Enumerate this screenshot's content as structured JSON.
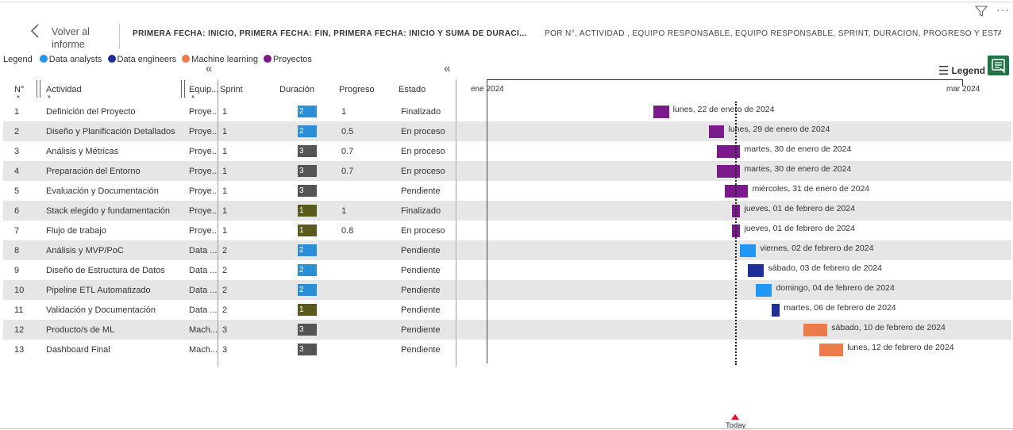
{
  "header": {
    "back_icon": "chevron-left-icon",
    "back_label": "Volver al informe",
    "title_1": "PRIMERA FECHA: INICIO, PRIMERA FECHA: FIN, PRIMERA FECHA: INICIO Y SUMA DE DURACI...",
    "title_2": "POR N°, ACTIVIDAD , EQUIPO RESPONSABLE, EQUIPO RESPONSABLE, SPRINT, DURACIÓN, PROGRESO Y ESTA...",
    "filter_icon": "filter-icon",
    "more_icon": "more-options-icon"
  },
  "legend": {
    "title": "Legend",
    "items": [
      {
        "label": "Data analysts",
        "color": "#2196f3"
      },
      {
        "label": "Data engineers",
        "color": "#1f2f9a"
      },
      {
        "label": "Machine learning",
        "color": "#ec7a4b"
      },
      {
        "label": "Proyectos",
        "color": "#7b1a8a"
      }
    ]
  },
  "columns": {
    "num": "N°",
    "actividad": "Actividad",
    "equipo": "Equip...",
    "sprint": "Sprint",
    "duracion": "Duración",
    "progreso": "Progreso",
    "estado": "Estado"
  },
  "rows": [
    {
      "n": "1",
      "actividad": "Definición del Proyecto",
      "equipo": "Proye...",
      "sprint": "1",
      "duracion": "2",
      "progreso": "1",
      "estado": "Finalizado",
      "bar_label": "lunes, 22 de enero de 2024"
    },
    {
      "n": "2",
      "actividad": "Diseño y Planificación Detallados",
      "equipo": "Proye...",
      "sprint": "1",
      "duracion": "2",
      "progreso": "0.5",
      "estado": "En proceso",
      "bar_label": "lunes, 29 de enero de 2024"
    },
    {
      "n": "3",
      "actividad": "Análisis y Métricas",
      "equipo": "Proye...",
      "sprint": "1",
      "duracion": "3",
      "progreso": "0.7",
      "estado": "En proceso",
      "bar_label": "martes, 30 de enero de 2024"
    },
    {
      "n": "4",
      "actividad": "Preparación del Entorno",
      "equipo": "Proye...",
      "sprint": "1",
      "duracion": "3",
      "progreso": "0.7",
      "estado": "En proceso",
      "bar_label": "martes, 30 de enero de 2024"
    },
    {
      "n": "5",
      "actividad": "Evaluación y Documentación",
      "equipo": "Proye...",
      "sprint": "1",
      "duracion": "3",
      "progreso": "",
      "estado": "Pendiente",
      "bar_label": "miércoles, 31 de enero de 2024"
    },
    {
      "n": "6",
      "actividad": "Stack elegido y fundamentación",
      "equipo": "Proye...",
      "sprint": "1",
      "duracion": "1",
      "progreso": "1",
      "estado": "Finalizado",
      "bar_label": "jueves, 01 de febrero de 2024"
    },
    {
      "n": "7",
      "actividad": "Flujo de trabajo",
      "equipo": "Proye...",
      "sprint": "1",
      "duracion": "1",
      "progreso": "0.8",
      "estado": "En proceso",
      "bar_label": "jueves, 01 de febrero de 2024"
    },
    {
      "n": "8",
      "actividad": "Análisis y MVP/PoC",
      "equipo": "Data ...",
      "sprint": "2",
      "duracion": "2",
      "progreso": "",
      "estado": "Pendiente",
      "bar_label": "viernes, 02 de febrero de 2024"
    },
    {
      "n": "9",
      "actividad": "Diseño de Estructura de Datos",
      "equipo": "Data ...",
      "sprint": "2",
      "duracion": "2",
      "progreso": "",
      "estado": "Pendiente",
      "bar_label": "sábado, 03 de febrero de 2024"
    },
    {
      "n": "10",
      "actividad": "Pipeline ETL Automatizado",
      "equipo": "Data ...",
      "sprint": "2",
      "duracion": "2",
      "progreso": "",
      "estado": "Pendiente",
      "bar_label": "domingo, 04 de febrero de 2024"
    },
    {
      "n": "11",
      "actividad": "Validación y Documentación",
      "equipo": "Data ...",
      "sprint": "2",
      "duracion": "1",
      "progreso": "",
      "estado": "Pendiente",
      "bar_label": "martes, 06 de febrero de 2024"
    },
    {
      "n": "12",
      "actividad": "Producto/s de ML",
      "equipo": "Mach...",
      "sprint": "3",
      "duracion": "3",
      "progreso": "",
      "estado": "Pendiente",
      "bar_label": "sábado, 10 de febrero de 2024"
    },
    {
      "n": "13",
      "actividad": "Dashboard Final",
      "equipo": "Mach...",
      "sprint": "3",
      "duracion": "3",
      "progreso": "",
      "estado": "Pendiente",
      "bar_label": "lunes, 12 de febrero de 2024"
    }
  ],
  "duration_colors": {
    "1": "#5a5a1a",
    "2": "#2a8fd6",
    "3": "#555555"
  },
  "gantt": {
    "axis_start_label": "ene 2024",
    "axis_end_label": "mar 2024",
    "today_label": "Today",
    "legend_button": "Legend",
    "legend_button_icon": "hamburger-icon",
    "export_icon": "export-to-excel-icon",
    "collapse_icon": "double-chevron-left-icon",
    "bars": [
      {
        "start": "2024-01-22",
        "end": "2024-01-24",
        "group": "Proyectos"
      },
      {
        "start": "2024-01-29",
        "end": "2024-01-31",
        "group": "Proyectos"
      },
      {
        "start": "2024-01-30",
        "end": "2024-02-02",
        "group": "Proyectos"
      },
      {
        "start": "2024-01-30",
        "end": "2024-02-02",
        "group": "Proyectos"
      },
      {
        "start": "2024-01-31",
        "end": "2024-02-03",
        "group": "Proyectos"
      },
      {
        "start": "2024-02-01",
        "end": "2024-02-02",
        "group": "Proyectos"
      },
      {
        "start": "2024-02-01",
        "end": "2024-02-02",
        "group": "Proyectos"
      },
      {
        "start": "2024-02-02",
        "end": "2024-02-04",
        "group": "Data analysts"
      },
      {
        "start": "2024-02-03",
        "end": "2024-02-05",
        "group": "Data engineers"
      },
      {
        "start": "2024-02-04",
        "end": "2024-02-06",
        "group": "Data analysts"
      },
      {
        "start": "2024-02-06",
        "end": "2024-02-07",
        "group": "Data engineers"
      },
      {
        "start": "2024-02-10",
        "end": "2024-02-13",
        "group": "Machine learning"
      },
      {
        "start": "2024-02-12",
        "end": "2024-02-15",
        "group": "Machine learning"
      }
    ]
  }
}
